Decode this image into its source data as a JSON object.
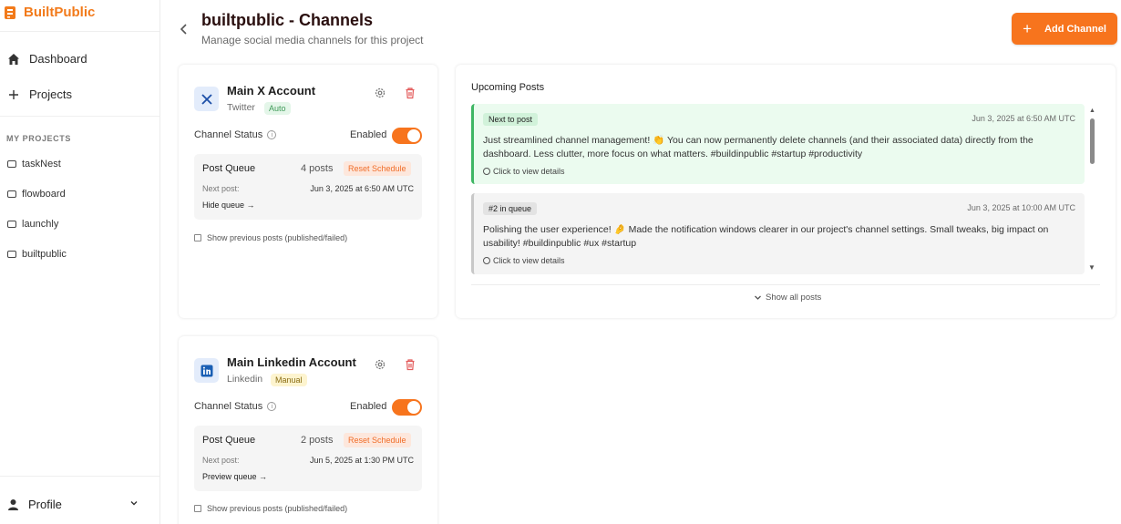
{
  "brand": {
    "name": "BuiltPublic",
    "accent": "#f27a1a"
  },
  "sidebar": {
    "nav": [
      {
        "label": "Dashboard",
        "icon": "home-icon"
      },
      {
        "label": "Projects",
        "icon": "plus-icon"
      }
    ],
    "section_label": "MY PROJECTS",
    "projects": [
      {
        "label": "taskNest"
      },
      {
        "label": "flowboard"
      },
      {
        "label": "launchly"
      },
      {
        "label": "builtpublic"
      }
    ],
    "profile_label": "Profile"
  },
  "header": {
    "title": "builtpublic - Channels",
    "subtitle": "Manage social media channels for this project",
    "add_button": "Add Channel",
    "add_button_icon": "+"
  },
  "channels": [
    {
      "name": "Main X Account",
      "platform": "Twitter",
      "mode": "Auto",
      "icon": "x-logo-icon",
      "status_label": "Channel Status",
      "enabled_label": "Enabled",
      "queue_title": "Post Queue",
      "queue_count": "4 posts",
      "reset_label": "Reset Schedule",
      "next_label": "Next post:",
      "next_value": "Jun 3, 2025 at 6:50 AM UTC",
      "queue_link": "Hide queue →",
      "show_previous": "Show previous posts (published/failed)"
    },
    {
      "name": "Main Linkedin Account",
      "platform": "Linkedin",
      "mode": "Manual",
      "icon": "linkedin-logo-icon",
      "status_label": "Channel Status",
      "enabled_label": "Enabled",
      "queue_title": "Post Queue",
      "queue_count": "2 posts",
      "reset_label": "Reset Schedule",
      "next_label": "Next post:",
      "next_value": "Jun 5, 2025 at 1:30 PM UTC",
      "queue_link": "Preview queue →",
      "show_previous": "Show previous posts (published/failed)"
    }
  ],
  "upcoming": {
    "title": "Upcoming Posts",
    "posts": [
      {
        "tag": "Next to post",
        "date": "Jun 3, 2025 at 6:50 AM UTC",
        "text": "Just streamlined channel management! 👏 You can now permanently delete channels (and their associated data) directly from the dashboard. Less clutter, more focus on what matters. #buildinpublic #startup #productivity",
        "details": "Click to view details"
      },
      {
        "tag": "#2 in queue",
        "date": "Jun 3, 2025 at 10:00 AM UTC",
        "text": "Polishing the user experience! 🤌 Made the notification windows clearer in our project's channel settings. Small tweaks, big impact on usability! #buildinpublic #ux #startup",
        "details": "Click to view details"
      }
    ],
    "show_all": "Show all posts"
  }
}
